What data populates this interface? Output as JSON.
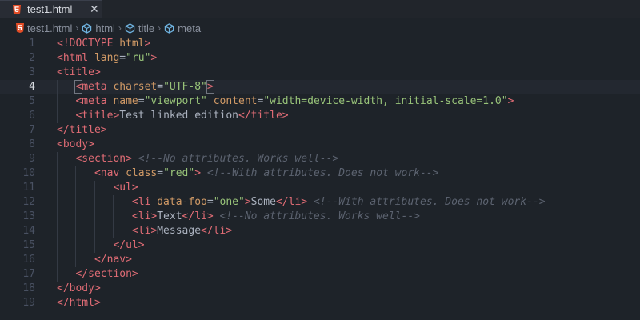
{
  "tab": {
    "title": "test1.html",
    "close_glyph": "✕",
    "icon": "html5-icon",
    "icon_color": "#e44d26"
  },
  "breadcrumb": [
    {
      "label": "test1.html",
      "icon": "html5-icon"
    },
    {
      "label": "html",
      "icon": "cube-icon"
    },
    {
      "label": "title",
      "icon": "cube-icon"
    },
    {
      "label": "meta",
      "icon": "cube-icon"
    }
  ],
  "editor": {
    "active_line": 4,
    "colors": {
      "tag": "#e06c75",
      "attr": "#d19a66",
      "string": "#98c379",
      "comment": "#5c6370",
      "text": "#abb2bf"
    },
    "lines": [
      {
        "n": "1",
        "tokens": [
          [
            "t",
            "<!DOCTYPE"
          ],
          [
            "p",
            " "
          ],
          [
            "a",
            "html"
          ],
          [
            "t",
            ">"
          ]
        ]
      },
      {
        "n": "2",
        "tokens": [
          [
            "t",
            "<html"
          ],
          [
            "p",
            " "
          ],
          [
            "a",
            "lang"
          ],
          [
            "p",
            "="
          ],
          [
            "s",
            "\"ru\""
          ],
          [
            "t",
            ">"
          ]
        ]
      },
      {
        "n": "3",
        "tokens": [
          [
            "t",
            "<title>"
          ]
        ]
      },
      {
        "n": "4",
        "tokens": [
          [
            "p",
            "   "
          ],
          [
            "t",
            "<meta"
          ],
          [
            "p",
            " "
          ],
          [
            "a",
            "charset"
          ],
          [
            "p",
            "="
          ],
          [
            "s",
            "\"UTF-8\""
          ],
          [
            "t",
            ">"
          ]
        ]
      },
      {
        "n": "5",
        "tokens": [
          [
            "p",
            "   "
          ],
          [
            "t",
            "<meta"
          ],
          [
            "p",
            " "
          ],
          [
            "a",
            "name"
          ],
          [
            "p",
            "="
          ],
          [
            "s",
            "\"viewport\""
          ],
          [
            "p",
            " "
          ],
          [
            "a",
            "content"
          ],
          [
            "p",
            "="
          ],
          [
            "s",
            "\"width=device-width, initial-scale=1.0\""
          ],
          [
            "t",
            ">"
          ]
        ]
      },
      {
        "n": "6",
        "tokens": [
          [
            "p",
            "   "
          ],
          [
            "t",
            "<title>"
          ],
          [
            "p",
            "Test linked edition"
          ],
          [
            "t",
            "</title>"
          ]
        ]
      },
      {
        "n": "7",
        "tokens": [
          [
            "t",
            "</title>"
          ]
        ]
      },
      {
        "n": "8",
        "tokens": [
          [
            "t",
            "<body>"
          ]
        ]
      },
      {
        "n": "9",
        "tokens": [
          [
            "p",
            "   "
          ],
          [
            "t",
            "<section>"
          ],
          [
            "p",
            " "
          ],
          [
            "c",
            "<!--No attributes. Works well-->"
          ]
        ]
      },
      {
        "n": "10",
        "tokens": [
          [
            "p",
            "      "
          ],
          [
            "t",
            "<nav"
          ],
          [
            "p",
            " "
          ],
          [
            "a",
            "class"
          ],
          [
            "p",
            "="
          ],
          [
            "s",
            "\"red\""
          ],
          [
            "t",
            ">"
          ],
          [
            "p",
            " "
          ],
          [
            "c",
            "<!--With attributes. Does not work-->"
          ]
        ]
      },
      {
        "n": "11",
        "tokens": [
          [
            "p",
            "         "
          ],
          [
            "t",
            "<ul>"
          ]
        ]
      },
      {
        "n": "12",
        "tokens": [
          [
            "p",
            "            "
          ],
          [
            "t",
            "<li"
          ],
          [
            "p",
            " "
          ],
          [
            "a",
            "data-foo"
          ],
          [
            "p",
            "="
          ],
          [
            "s",
            "\"one\""
          ],
          [
            "t",
            ">"
          ],
          [
            "p",
            "Some"
          ],
          [
            "t",
            "</li>"
          ],
          [
            "p",
            " "
          ],
          [
            "c",
            "<!--With attributes. Does not work-->"
          ]
        ]
      },
      {
        "n": "13",
        "tokens": [
          [
            "p",
            "            "
          ],
          [
            "t",
            "<li>"
          ],
          [
            "p",
            "Text"
          ],
          [
            "t",
            "</li>"
          ],
          [
            "p",
            " "
          ],
          [
            "c",
            "<!--No attributes. Works well-->"
          ]
        ]
      },
      {
        "n": "14",
        "tokens": [
          [
            "p",
            "            "
          ],
          [
            "t",
            "<li>"
          ],
          [
            "p",
            "Message"
          ],
          [
            "t",
            "</li>"
          ]
        ]
      },
      {
        "n": "15",
        "tokens": [
          [
            "p",
            "         "
          ],
          [
            "t",
            "</ul>"
          ]
        ]
      },
      {
        "n": "16",
        "tokens": [
          [
            "p",
            "      "
          ],
          [
            "t",
            "</nav>"
          ]
        ]
      },
      {
        "n": "17",
        "tokens": [
          [
            "p",
            "   "
          ],
          [
            "t",
            "</section>"
          ]
        ]
      },
      {
        "n": "18",
        "tokens": [
          [
            "t",
            "</body>"
          ]
        ]
      },
      {
        "n": "19",
        "tokens": [
          [
            "t",
            "</html>"
          ]
        ]
      }
    ]
  }
}
